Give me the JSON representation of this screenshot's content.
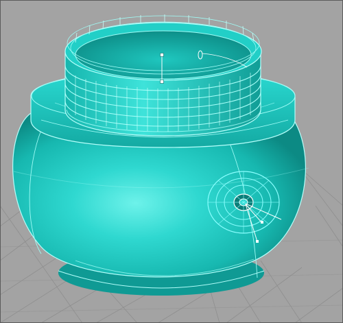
{
  "viewport": {
    "background_color": "#a3a3a3",
    "grid_line_color": "#8e8e8e",
    "grid_visible": true
  },
  "model": {
    "shape": "threaded jar",
    "surface_color": "#19c8c0",
    "surface_highlight_color": "#6af0e8",
    "surface_shadow_color": "#0a8580",
    "isocurve_color": "#7ff8f2",
    "selection_outline_color": "#b5fffb"
  },
  "gizmo": {
    "icon": "gumball-manipulator-icon",
    "ring_color": "#8affff"
  },
  "border_color": "#5a5a5a"
}
